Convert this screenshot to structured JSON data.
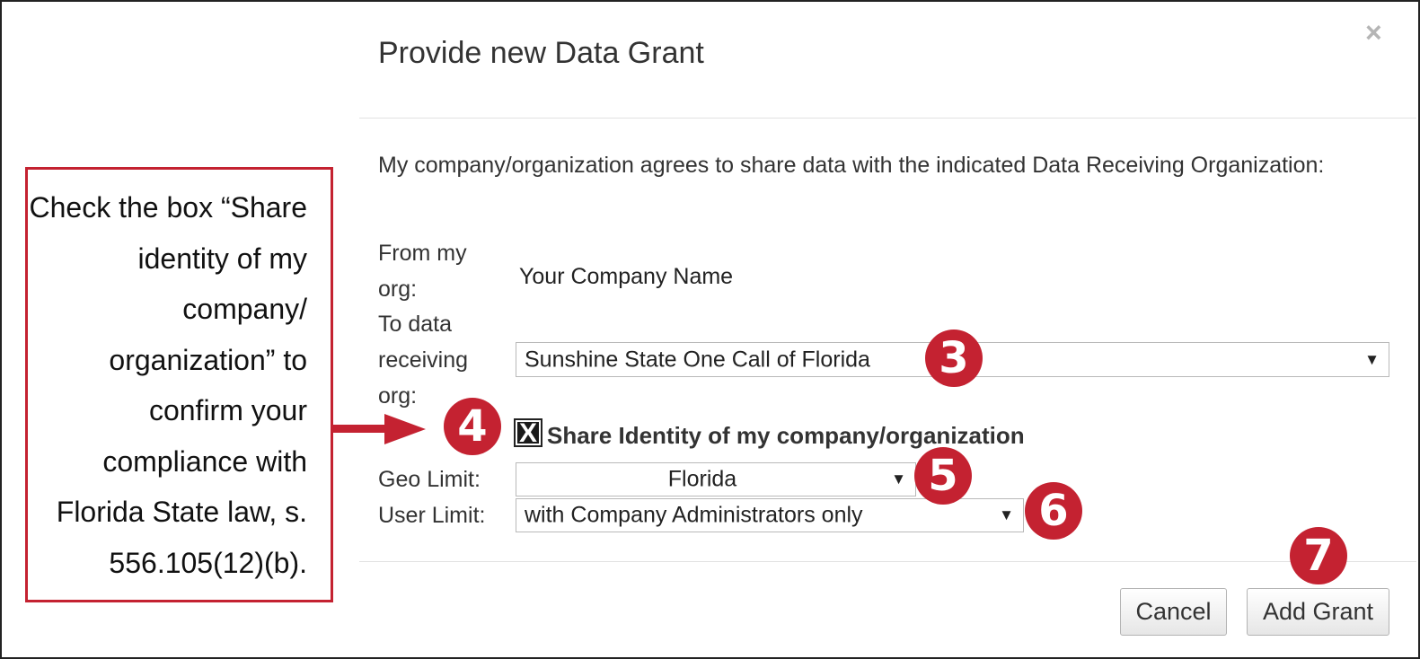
{
  "dialog": {
    "title": "Provide new Data Grant",
    "close_glyph": "×",
    "intro": "My company/organization agrees to share data with the indicated Data Receiving Organization:",
    "from_label": "From my org:",
    "from_value": "Your Company Name",
    "to_label": "To data receiving org:",
    "to_value": "Sunshine State One Call of Florida",
    "share_identity": {
      "label": "Share Identity of my company/organization",
      "checked": true,
      "mark": "X"
    },
    "geo_label": "Geo Limit:",
    "geo_value": "Florida",
    "user_label": "User Limit:",
    "user_value": "with Company Administrators only",
    "dropdown_arrow": "▼",
    "cancel_label": "Cancel",
    "add_grant_label": "Add Grant"
  },
  "callout": {
    "text": "Check the box “Share identity of my company/ organization” to confirm your compliance with Florida State law, s. 556.105(12)(b)."
  },
  "badges": [
    "3",
    "4",
    "5",
    "6",
    "7"
  ],
  "colors": {
    "accent_red": "#c42231",
    "text": "#333333",
    "divider": "#e2e2e2",
    "border": "#222222"
  },
  "icons": [
    "close-icon",
    "dropdown-arrow-icon",
    "checkbox-x-icon",
    "arrow-right-icon"
  ]
}
